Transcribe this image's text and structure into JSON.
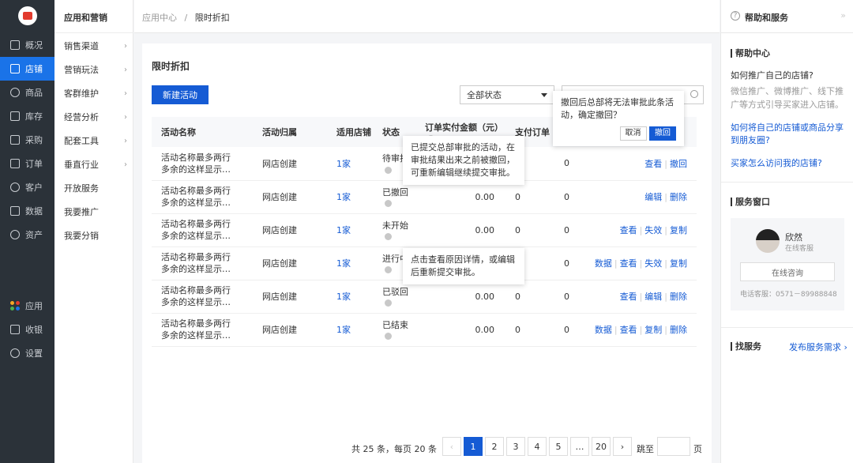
{
  "nav": {
    "items": [
      {
        "label": "概况",
        "icon": "monitor-icon"
      },
      {
        "label": "店铺",
        "icon": "store-icon"
      },
      {
        "label": "商品",
        "icon": "tag-icon"
      },
      {
        "label": "库存",
        "icon": "warehouse-icon"
      },
      {
        "label": "采购",
        "icon": "cart-icon"
      },
      {
        "label": "订单",
        "icon": "order-icon"
      },
      {
        "label": "客户",
        "icon": "user-icon"
      },
      {
        "label": "数据",
        "icon": "chart-icon"
      },
      {
        "label": "资产",
        "icon": "yen-icon"
      }
    ],
    "bottom": [
      {
        "label": "应用",
        "icon": "apps-icon"
      },
      {
        "label": "收银",
        "icon": "cashier-icon"
      },
      {
        "label": "设置",
        "icon": "gear-icon"
      }
    ]
  },
  "submenu": {
    "title": "应用和营销",
    "items": [
      {
        "label": "销售渠道",
        "chevron": true
      },
      {
        "label": "营销玩法",
        "chevron": true
      },
      {
        "label": "客群维护",
        "chevron": true
      },
      {
        "label": "经营分析",
        "chevron": true
      },
      {
        "label": "配套工具",
        "chevron": true
      },
      {
        "label": "垂直行业",
        "chevron": true
      },
      {
        "label": "开放服务",
        "chevron": false
      },
      {
        "label": "我要推广",
        "chevron": false
      },
      {
        "label": "我要分销",
        "chevron": false
      }
    ]
  },
  "breadcrumb": {
    "root": "应用中心",
    "sep": "/",
    "current": "限时折扣"
  },
  "main": {
    "title": "限时折扣",
    "new_button": "新建活动",
    "status_filter": "全部状态",
    "columns": [
      "活动名称",
      "活动归属",
      "适用店铺",
      "状态",
      "订单实付金额（元）",
      "支付订单",
      "",
      ""
    ],
    "rows": [
      {
        "name1": "活动名称最多两行",
        "name2": "多余的这样显示…",
        "owner": "网店创建",
        "shop": "1家",
        "status": "待审批",
        "amount": "",
        "orders": "",
        "extra": "0",
        "actions": [
          "查看",
          "撤回"
        ]
      },
      {
        "name1": "活动名称最多两行",
        "name2": "多余的这样显示…",
        "owner": "网店创建",
        "shop": "1家",
        "status": "已撤回",
        "amount": "0.00",
        "orders": "0",
        "extra": "0",
        "actions": [
          "编辑",
          "删除"
        ]
      },
      {
        "name1": "活动名称最多两行",
        "name2": "多余的这样显示…",
        "owner": "网店创建",
        "shop": "1家",
        "status": "未开始",
        "amount": "0.00",
        "orders": "0",
        "extra": "0",
        "actions": [
          "查看",
          "失效",
          "复制"
        ]
      },
      {
        "name1": "活动名称最多两行",
        "name2": "多余的这样显示…",
        "owner": "网店创建",
        "shop": "1家",
        "status": "进行中",
        "amount": "",
        "orders": "",
        "extra": "0",
        "actions": [
          "数据",
          "查看",
          "失效",
          "复制"
        ]
      },
      {
        "name1": "活动名称最多两行",
        "name2": "多余的这样显示…",
        "owner": "网店创建",
        "shop": "1家",
        "status": "已驳回",
        "amount": "0.00",
        "orders": "0",
        "extra": "0",
        "actions": [
          "查看",
          "编辑",
          "删除"
        ]
      },
      {
        "name1": "活动名称最多两行",
        "name2": "多余的这样显示…",
        "owner": "网店创建",
        "shop": "1家",
        "status": "已结束",
        "amount": "0.00",
        "orders": "0",
        "extra": "0",
        "actions": [
          "数据",
          "查看",
          "复制",
          "删除"
        ]
      }
    ],
    "popconfirm": {
      "text": "撤回后总部将无法审批此条活动，确定撤回？",
      "cancel": "取消",
      "ok": "撤回"
    },
    "tooltip1": "已提交总部审批的活动，在审批结果出来之前被撤回，可重新编辑继续提交审批。",
    "tooltip2": "点击查看原因详情，或编辑后重新提交审批。",
    "pagination": {
      "summary": "共 25 条，每页 20 条",
      "pages": [
        "1",
        "2",
        "3",
        "4",
        "5",
        "…",
        "20"
      ],
      "current": "1",
      "goto_label": "跳至",
      "page_unit": "页"
    }
  },
  "help": {
    "title": "帮助和服务",
    "center_title": "帮助中心",
    "q1": "如何推广自己的店铺?",
    "a1": "微信推广、微博推广、线下推广等方式引导买家进入店铺。",
    "link1": "如何将自己的店铺或商品分享到朋友圈?",
    "link2": "买家怎么访问我的店铺?",
    "service_title": "服务窗口",
    "agent_name": "欣然",
    "agent_role": "在线客服",
    "consult_button": "在线咨询",
    "phone": "电话客服：0571－89988848",
    "find_title": "找服务",
    "publish_link": "发布服务需求 ›"
  }
}
